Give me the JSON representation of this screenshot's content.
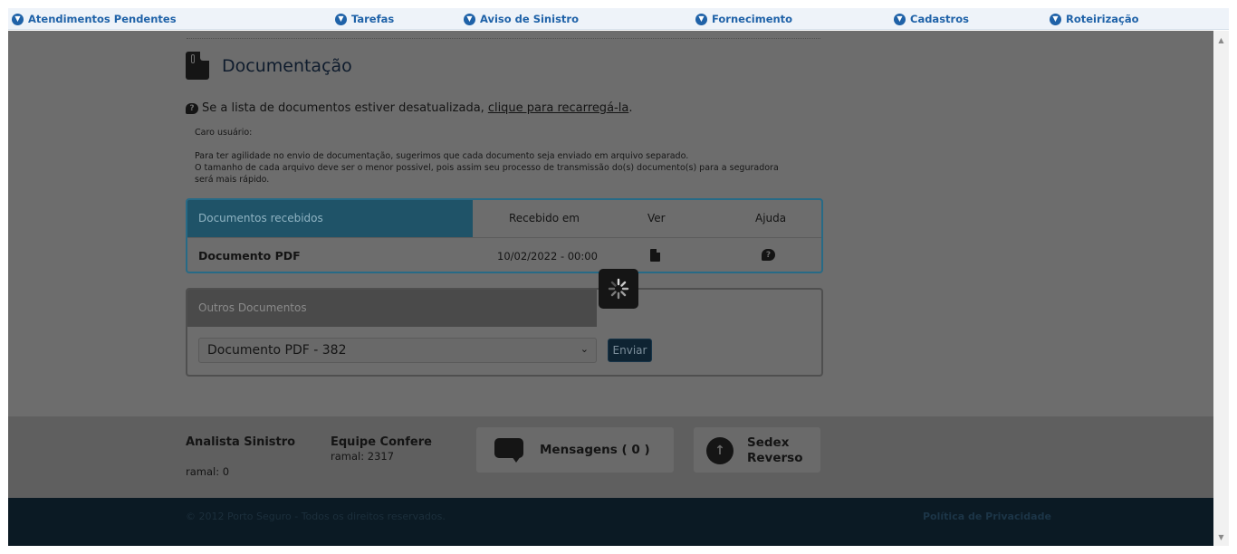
{
  "nav": {
    "items": [
      {
        "label": "Atendimentos Pendentes",
        "icon": "chevron-down-circle-icon"
      },
      {
        "label": "Tarefas",
        "icon": "chevron-down-circle-icon"
      },
      {
        "label": "Aviso de Sinistro",
        "icon": "chevron-down-circle-icon"
      },
      {
        "label": "Fornecimento",
        "icon": "chevron-down-circle-icon"
      },
      {
        "label": "Cadastros",
        "icon": "chevron-down-circle-icon"
      },
      {
        "label": "Roteirização",
        "icon": "chevron-down-circle-icon"
      }
    ]
  },
  "page": {
    "title": "Documentação",
    "reload_prefix": "Se a lista de documentos estiver desatualizada,",
    "reload_link": "clique para recarregá-la",
    "reload_suffix": ".",
    "note_greeting": "Caro usuário:",
    "note_line1": "Para ter agilidade no envio de documentação, sugerimos que cada documento seja enviado em arquivo separado.",
    "note_line2": "O tamanho de cada arquivo deve ser o menor possivel, pois assim seu processo de transmissão do(s) documento(s) para a seguradora",
    "note_line3": "será mais rápido."
  },
  "received": {
    "header": "Documentos recebidos",
    "col_received_at": "Recebido em",
    "col_view": "Ver",
    "col_help": "Ajuda",
    "rows": [
      {
        "name": "Documento PDF",
        "date": "10/02/2022 - 00:00"
      }
    ]
  },
  "other": {
    "header": "Outros Documentos",
    "select_value": "Documento PDF - 382",
    "send_label": "Enviar"
  },
  "contacts": {
    "analyst_name": "Analista Sinistro",
    "analyst_ext": "ramal: 0",
    "team_name": "Equipe Confere",
    "team_ext": "ramal: 2317",
    "messages_label": "Mensagens ( 0 )",
    "sedex_line1": "Sedex",
    "sedex_line2": "Reverso"
  },
  "footer": {
    "copyright": "© 2012 Porto Seguro - Todos os direitos reservados.",
    "privacy": "Política de Privacidade"
  },
  "colors": {
    "nav_text": "#1f62a8",
    "overlay_bg": "#6d6d6d",
    "footer_bg": "#0b1a24",
    "accent_blue": "#276a86"
  }
}
